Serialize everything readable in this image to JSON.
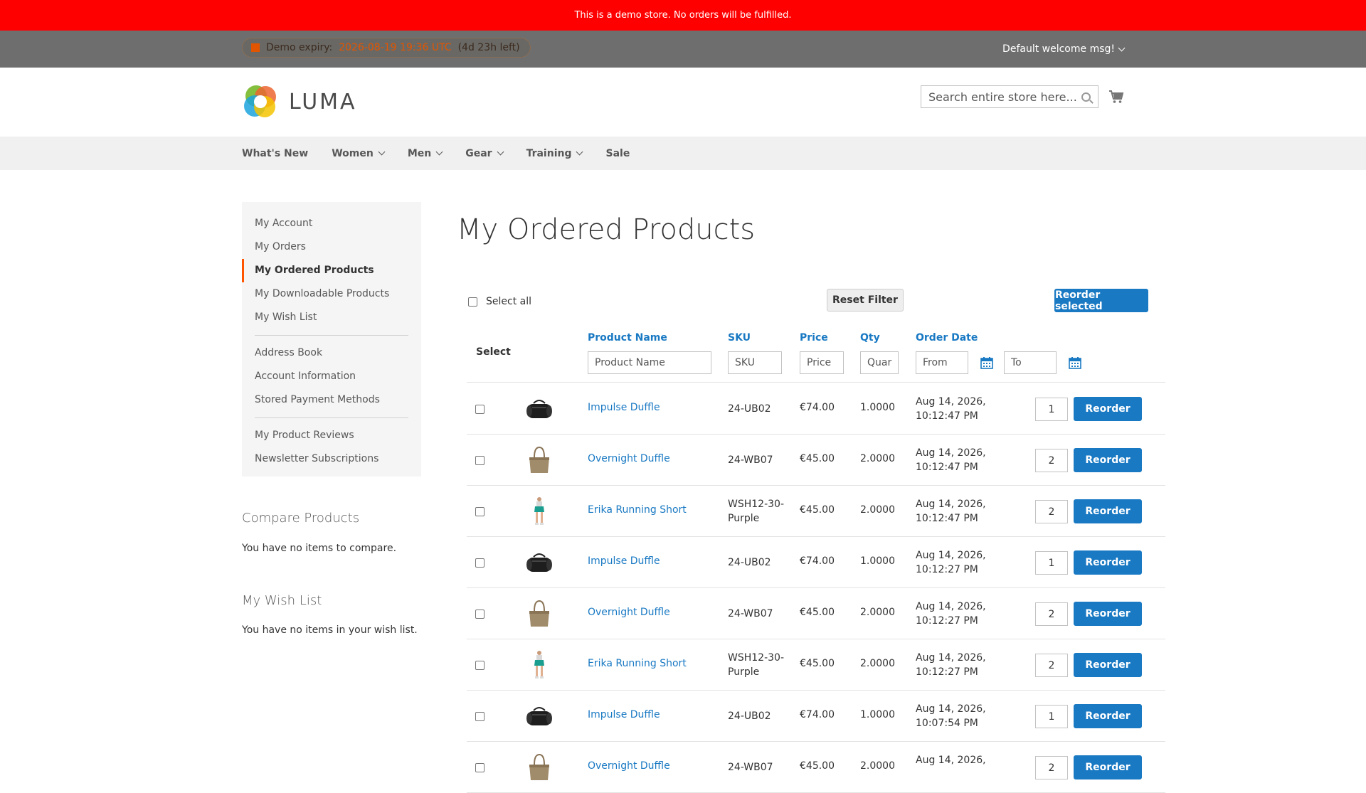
{
  "demo_banner": "This is a demo store. No orders will be fulfilled.",
  "panel": {
    "expiry_label": "Demo expiry:",
    "expiry_date": "2026-08-19 19:36 UTC",
    "expiry_left": "(4d 23h left)",
    "welcome": "Default welcome msg!"
  },
  "header": {
    "logo_text": "LUMA",
    "search_placeholder": "Search entire store here..."
  },
  "nav": [
    {
      "label": "What's New",
      "dropdown": false
    },
    {
      "label": "Women",
      "dropdown": true
    },
    {
      "label": "Men",
      "dropdown": true
    },
    {
      "label": "Gear",
      "dropdown": true
    },
    {
      "label": "Training",
      "dropdown": true
    },
    {
      "label": "Sale",
      "dropdown": false
    }
  ],
  "sidebar": {
    "group1": [
      "My Account",
      "My Orders",
      "My Ordered Products",
      "My Downloadable Products",
      "My Wish List"
    ],
    "group2": [
      "Address Book",
      "Account Information",
      "Stored Payment Methods"
    ],
    "group3": [
      "My Product Reviews",
      "Newsletter Subscriptions"
    ],
    "active": "My Ordered Products"
  },
  "compare": {
    "title": "Compare Products",
    "text": "You have no items to compare."
  },
  "wishlist": {
    "title": "My Wish List",
    "text": "You have no items in your wish list."
  },
  "page_title": "My Ordered Products",
  "toolbar": {
    "select_all": "Select all",
    "reset_filter": "Reset Filter",
    "reorder_selected": "Reorder selected"
  },
  "table": {
    "headers": {
      "select": "Select",
      "product_name": "Product Name",
      "sku": "SKU",
      "price": "Price",
      "qty": "Qty",
      "order_date": "Order Date"
    },
    "filters": {
      "product_name": "Product Name",
      "sku": "SKU",
      "price": "Price",
      "qty": "Quar",
      "from": "From",
      "to": "To"
    },
    "reorder_label": "Reorder",
    "rows": [
      {
        "name": "Impulse Duffle",
        "sku": "24-UB02",
        "price": "€74.00",
        "qty": "1.0000",
        "date1": "Aug 14, 2026,",
        "date2": "10:12:47 PM",
        "reorder_qty": "1",
        "thumb": "black-duffle"
      },
      {
        "name": "Overnight Duffle",
        "sku": "24-WB07",
        "price": "€45.00",
        "qty": "2.0000",
        "date1": "Aug 14, 2026,",
        "date2": "10:12:47 PM",
        "reorder_qty": "2",
        "thumb": "tan-tote"
      },
      {
        "name": "Erika Running Short",
        "sku": "WSH12-30-Purple",
        "price": "€45.00",
        "qty": "2.0000",
        "date1": "Aug 14, 2026,",
        "date2": "10:12:47 PM",
        "reorder_qty": "2",
        "thumb": "running-short"
      },
      {
        "name": "Impulse Duffle",
        "sku": "24-UB02",
        "price": "€74.00",
        "qty": "1.0000",
        "date1": "Aug 14, 2026,",
        "date2": "10:12:27 PM",
        "reorder_qty": "1",
        "thumb": "black-duffle"
      },
      {
        "name": "Overnight Duffle",
        "sku": "24-WB07",
        "price": "€45.00",
        "qty": "2.0000",
        "date1": "Aug 14, 2026,",
        "date2": "10:12:27 PM",
        "reorder_qty": "2",
        "thumb": "tan-tote"
      },
      {
        "name": "Erika Running Short",
        "sku": "WSH12-30-Purple",
        "price": "€45.00",
        "qty": "2.0000",
        "date1": "Aug 14, 2026,",
        "date2": "10:12:27 PM",
        "reorder_qty": "2",
        "thumb": "running-short"
      },
      {
        "name": "Impulse Duffle",
        "sku": "24-UB02",
        "price": "€74.00",
        "qty": "1.0000",
        "date1": "Aug 14, 2026,",
        "date2": "10:07:54 PM",
        "reorder_qty": "1",
        "thumb": "black-duffle"
      },
      {
        "name": "Overnight Duffle",
        "sku": "24-WB07",
        "price": "€45.00",
        "qty": "2.0000",
        "date1": "Aug 14, 2026,",
        "date2": "",
        "reorder_qty": "2",
        "thumb": "tan-tote"
      }
    ]
  },
  "colors": {
    "accent": "#1979c3",
    "banner": "#ff0000",
    "active_marker": "#ff5501"
  }
}
